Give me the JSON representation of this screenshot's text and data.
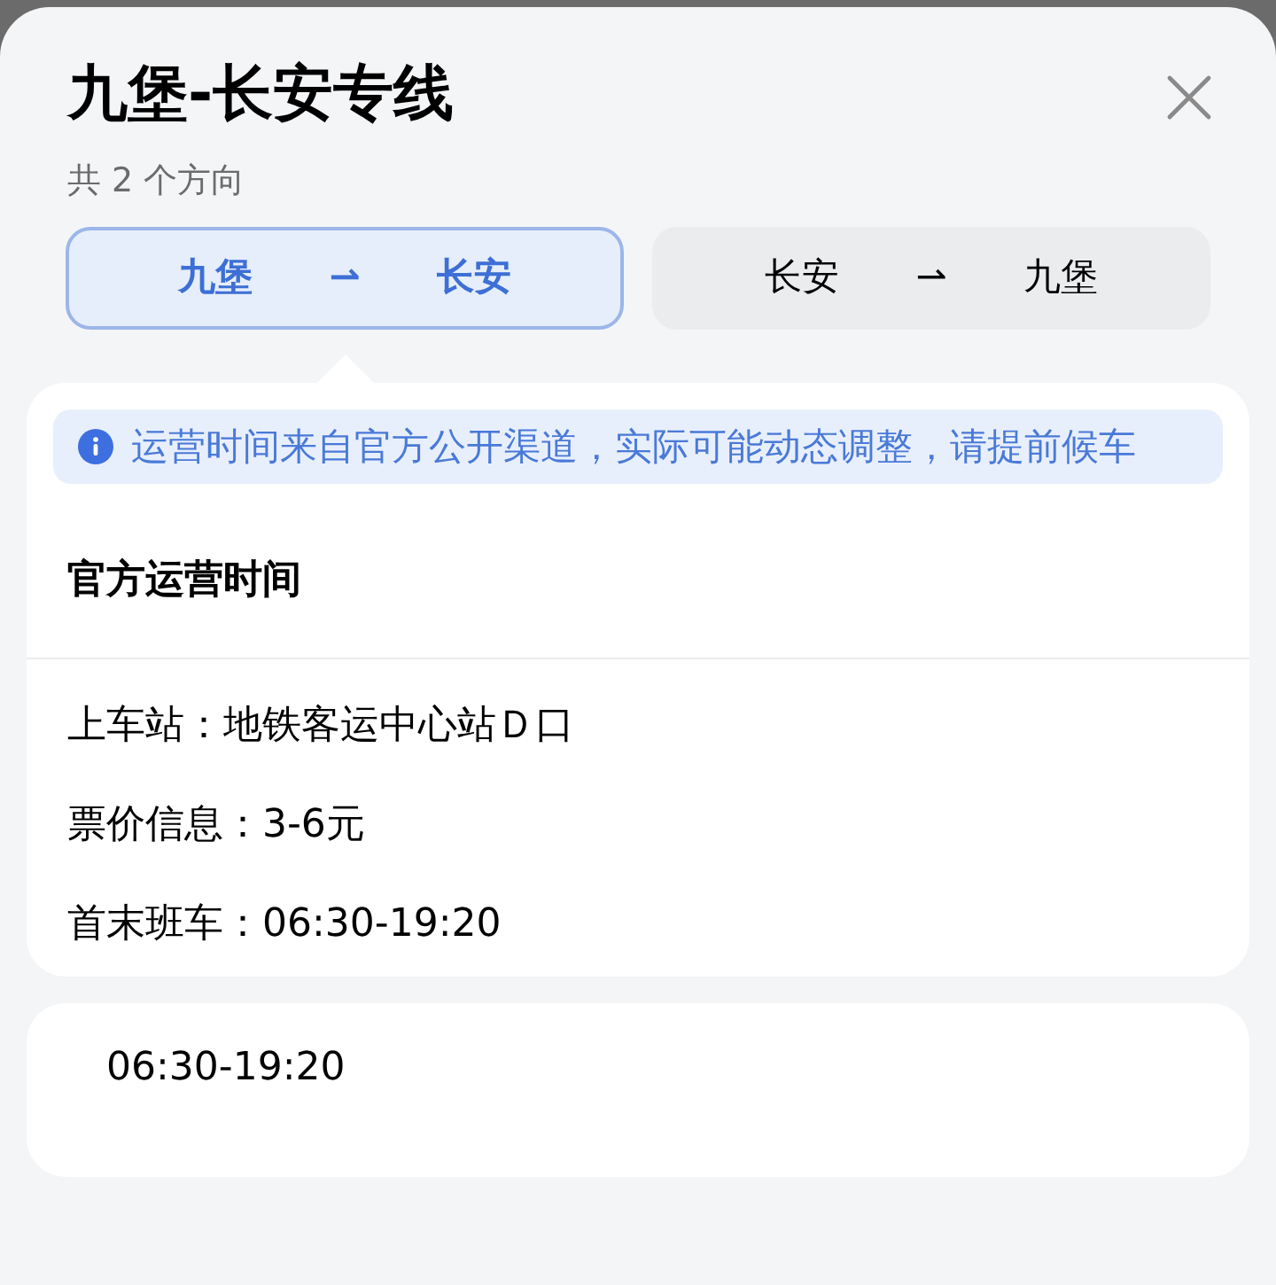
{
  "title": "九堡-长安专线",
  "subtitle": "共 2 个方向",
  "directions": [
    {
      "from": "九堡",
      "arrow": "⇀",
      "to": "长安",
      "selected": true
    },
    {
      "from": "长安",
      "arrow": "⇀",
      "to": "九堡",
      "selected": false
    }
  ],
  "notice": "运营时间来自官方公开渠道，实际可能动态调整，请提前候车",
  "section_title": "官方运营时间",
  "details": [
    "上车站：地铁客运中心站Ｄ口",
    "票价信息：3-6元",
    "首末班车：06:30-19:20"
  ],
  "schedule": "06:30-19:20"
}
